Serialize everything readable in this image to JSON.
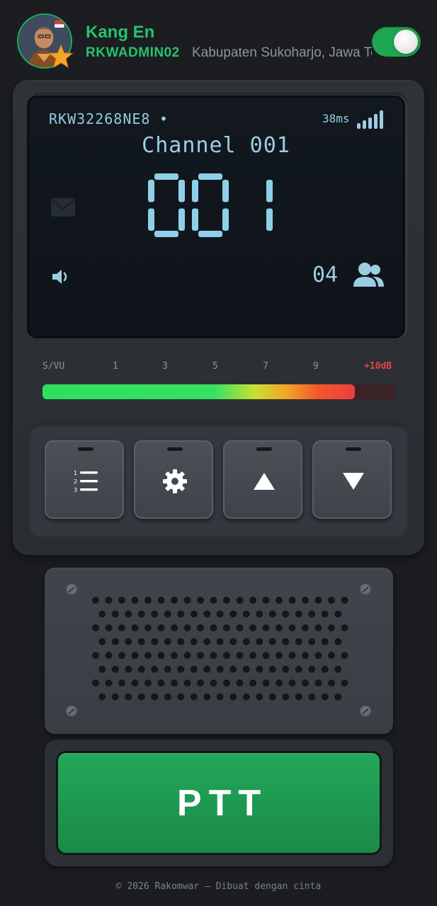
{
  "header": {
    "user_name": "Kang En",
    "user_id": "RKWADMIN02",
    "location": "Kabupaten Sukoharjo, Jawa Tengah",
    "toggle_on": true,
    "avatar_icon": "user-avatar",
    "badge_icon": "star-icon"
  },
  "screen": {
    "device_id": "RKW32268NE8",
    "dot": "•",
    "ping": "38ms",
    "channel_name": "Channel 001",
    "channel_number": "001",
    "users_count": "04",
    "icons": {
      "signal": "signal-bars-icon",
      "mail": "mail-icon",
      "volume": "volume-icon",
      "users": "users-icon"
    }
  },
  "vu_meter": {
    "labels": [
      "S/VU",
      "1",
      "3",
      "5",
      "7",
      "9",
      "+10dB"
    ],
    "level_fraction": 0.885
  },
  "controls": [
    {
      "name": "channel-list-button",
      "icon": "numbered-list-icon"
    },
    {
      "name": "settings-button",
      "icon": "gear-icon"
    },
    {
      "name": "channel-up-button",
      "icon": "triangle-up-icon"
    },
    {
      "name": "channel-down-button",
      "icon": "triangle-down-icon"
    }
  ],
  "ptt": {
    "label": "PTT"
  },
  "footer": {
    "text": "© 2026 Rakomwar — Dibuat dengan cinta"
  },
  "colors": {
    "accent_green": "#27c26c",
    "lcd_text": "#9dcde2",
    "ptt_green": "#1f9c52",
    "peak_red": "#f03c3c"
  }
}
